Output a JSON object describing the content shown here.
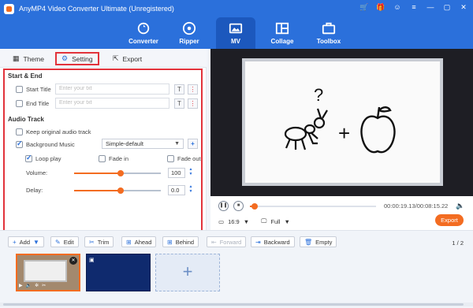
{
  "app": {
    "title": "AnyMP4 Video Converter Ultimate (Unregistered)"
  },
  "window_icons": [
    "cart-icon",
    "gift-icon",
    "user-icon",
    "menu-icon",
    "minimize-icon",
    "maximize-icon",
    "close-icon"
  ],
  "nav": {
    "items": [
      {
        "label": "Converter",
        "icon": "refresh-icon"
      },
      {
        "label": "Ripper",
        "icon": "disc-icon"
      },
      {
        "label": "MV",
        "icon": "image-icon",
        "active": true
      },
      {
        "label": "Collage",
        "icon": "collage-icon"
      },
      {
        "label": "Toolbox",
        "icon": "toolbox-icon"
      }
    ]
  },
  "tabs": {
    "theme": "Theme",
    "setting": "Setting",
    "export": "Export"
  },
  "settings": {
    "start_end_title": "Start & End",
    "start_title_label": "Start Title",
    "end_title_label": "End Title",
    "title_placeholder": "Enter your txt",
    "audio_track_title": "Audio Track",
    "keep_original_label": "Keep original audio track",
    "background_music_label": "Background Music",
    "music_select_value": "Simple-default",
    "loop_play_label": "Loop play",
    "fade_in_label": "Fade in",
    "fade_out_label": "Fade out",
    "volume_label": "Volume:",
    "volume_value": "100",
    "volume_fraction": 0.54,
    "delay_label": "Delay:",
    "delay_value": "0.0",
    "delay_fraction": 0.54
  },
  "preview": {
    "symbol_plus": "+",
    "symbol_question": "?"
  },
  "player": {
    "time": "00:00:19.13/00:08:15.22",
    "aspect_ratio": "16:9",
    "zoom": "Full",
    "export_label": "Export",
    "progress_fraction": 0.04
  },
  "toolbar": {
    "add": "Add",
    "edit": "Edit",
    "trim": "Trim",
    "ahead": "Ahead",
    "behind": "Behind",
    "forward": "Forward",
    "backward": "Backward",
    "empty": "Empty",
    "page_count": "1 / 2"
  },
  "colors": {
    "brand_blue": "#2b70db",
    "accent_orange": "#f36c21",
    "highlight_red": "#e2333b"
  }
}
